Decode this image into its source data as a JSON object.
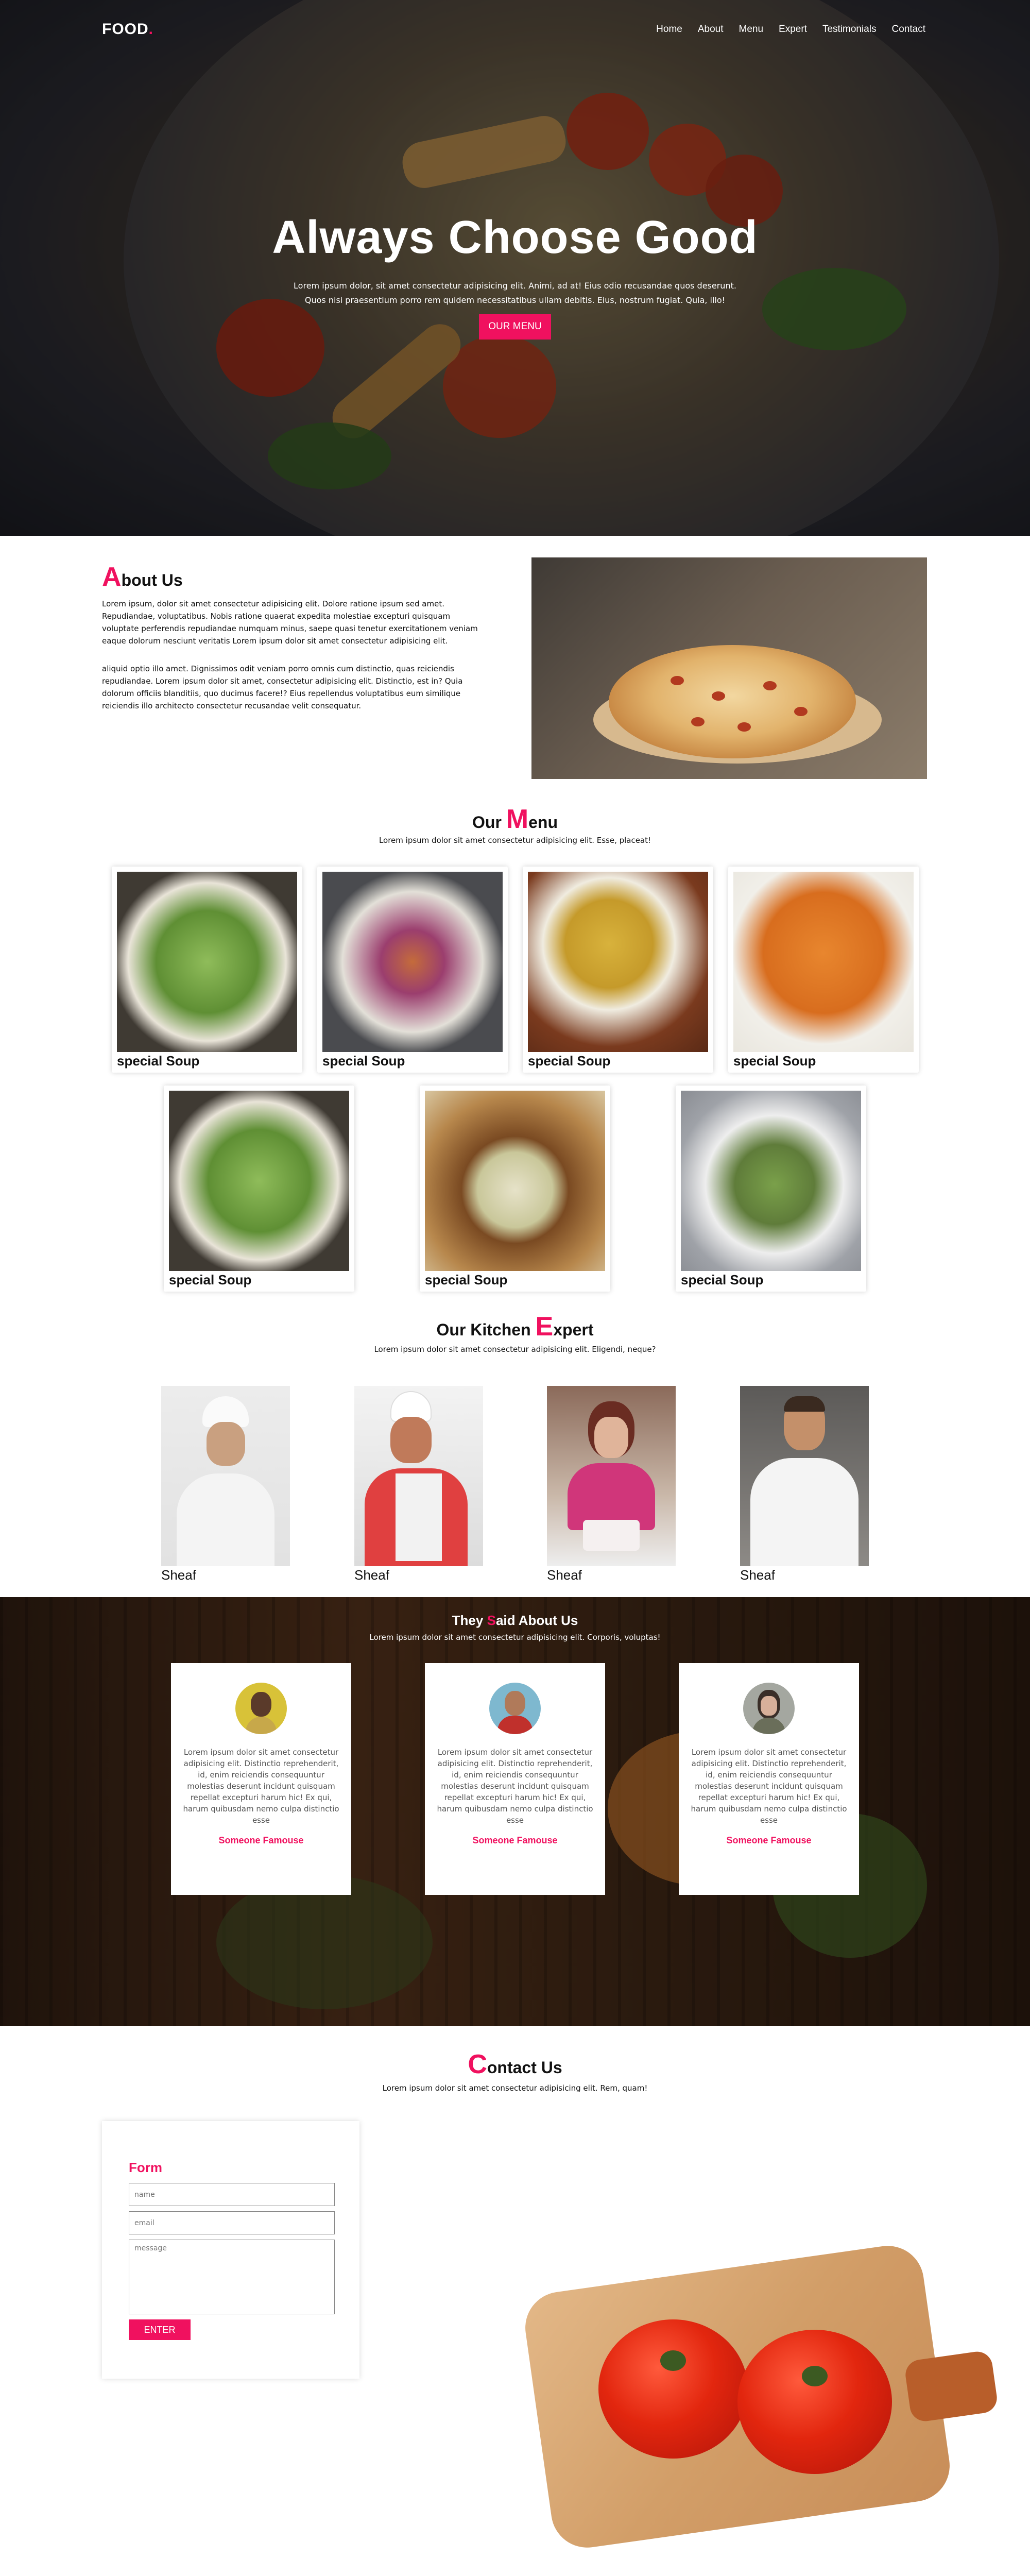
{
  "nav": {
    "logo": "FOOD",
    "logo_dot": ".",
    "items": [
      "Home",
      "About",
      "Menu",
      "Expert",
      "Testimonials",
      "Contact"
    ]
  },
  "hero": {
    "title": "Always Choose Good",
    "text": "Lorem ipsum dolor, sit amet consectetur adipisicing elit. Animi, ad at! Eius odio recusandae quos deserunt. Quos nisi praesentium porro rem quidem necessitatibus ullam debitis. Eius, nostrum fugiat. Quia, illo!",
    "button": "OUR MENU"
  },
  "about": {
    "title_first": "A",
    "title_rest": "bout Us",
    "para1": "Lorem ipsum, dolor sit amet consectetur adipisicing elit. Dolore ratione ipsum sed amet. Repudiandae, voluptatibus. Nobis ratione quaerat expedita molestiae excepturi quisquam voluptate perferendis repudiandae numquam minus, saepe quasi tenetur exercitationem veniam eaque dolorum nesciunt veritatis Lorem ipsum dolor sit amet consectetur adipisicing elit.",
    "para2": "aliquid optio illo amet. Dignissimos odit veniam porro omnis cum distinctio, quas reiciendis repudiandae. Lorem ipsum dolor sit amet, consectetur adipisicing elit. Distinctio, est in? Quia dolorum officiis blanditiis, quo ducimus facere!? Eius repellendus voluptatibus eum similique reiciendis illo architecto consectetur recusandae velit consequatur."
  },
  "menu": {
    "title_a": "Our ",
    "title_b": "M",
    "title_c": "enu",
    "subtitle": "Lorem ipsum dolor sit amet consectetur adipisicing elit. Esse, placeat!",
    "items": [
      {
        "name": "special Soup"
      },
      {
        "name": "special Soup"
      },
      {
        "name": "special Soup"
      },
      {
        "name": "special Soup"
      },
      {
        "name": "special Soup"
      },
      {
        "name": "special Soup"
      },
      {
        "name": "special Soup"
      }
    ]
  },
  "experts": {
    "title_a": "Our Kitchen ",
    "title_b": "E",
    "title_c": "xpert",
    "subtitle": "Lorem ipsum dolor sit amet consectetur adipisicing elit. Eligendi, neque?",
    "people": [
      {
        "name": "Sheaf"
      },
      {
        "name": "Sheaf"
      },
      {
        "name": "Sheaf"
      },
      {
        "name": "Sheaf"
      }
    ]
  },
  "testimonials": {
    "title_a": "They ",
    "title_b": "S",
    "title_c": "aid About Us",
    "subtitle": "Lorem ipsum dolor sit amet consectetur adipisicing elit. Corporis, voluptas!",
    "items": [
      {
        "quote": "Lorem ipsum dolor sit amet consectetur adipisicing elit. Distinctio reprehenderit, id, enim reiciendis consequuntur molestias deserunt incidunt quisquam repellat excepturi harum hic! Ex qui, harum quibusdam nemo culpa distinctio esse",
        "name": "Someone Famouse"
      },
      {
        "quote": "Lorem ipsum dolor sit amet consectetur adipisicing elit. Distinctio reprehenderit, id, enim reiciendis consequuntur molestias deserunt incidunt quisquam repellat excepturi harum hic! Ex qui, harum quibusdam nemo culpa distinctio esse",
        "name": "Someone Famouse"
      },
      {
        "quote": "Lorem ipsum dolor sit amet consectetur adipisicing elit. Distinctio reprehenderit, id, enim reiciendis consequuntur molestias deserunt incidunt quisquam repellat excepturi harum hic! Ex qui, harum quibusdam nemo culpa distinctio esse",
        "name": "Someone Famouse"
      }
    ]
  },
  "contact": {
    "title_a": "C",
    "title_b": "ontact Us",
    "subtitle": "Lorem ipsum dolor sit amet consectetur adipisicing elit. Rem, quam!",
    "form_title": "Form",
    "name_placeholder": "name",
    "email_placeholder": "email",
    "message_placeholder": "message",
    "button": "ENTER"
  },
  "colors": {
    "accent": "#f0115f"
  }
}
